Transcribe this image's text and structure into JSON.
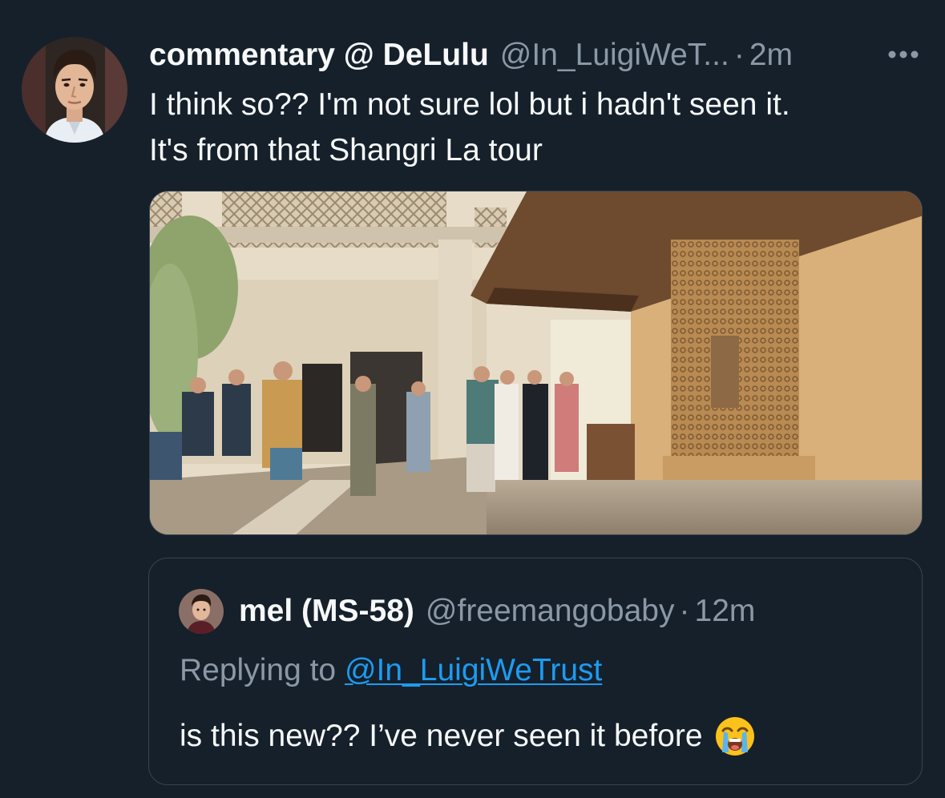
{
  "tweet": {
    "author": {
      "display_name": "commentary @ DeLulu",
      "handle": "@In_LuigiWeT...",
      "time": "2m"
    },
    "text_lines": [
      "I think so?? I'm not sure lol but i hadn't seen it.",
      "It's from that Shangri La tour"
    ],
    "dot": "·",
    "media_icon": "photo"
  },
  "quoted_tweet": {
    "author": {
      "display_name": "mel (MS-58)",
      "handle": "@freemangobaby",
      "time": "12m"
    },
    "replying_prefix": "Replying to",
    "replying_handle": "@In_LuigiWeTrust",
    "text": "is this new?? I’ve never seen it before",
    "emoji": "loudly-crying-face-icon"
  },
  "colors": {
    "background": "#15202b",
    "text": "#f7f9f9",
    "secondary": "#8b98a5",
    "link": "#1d9bf0",
    "border": "#38444d"
  }
}
